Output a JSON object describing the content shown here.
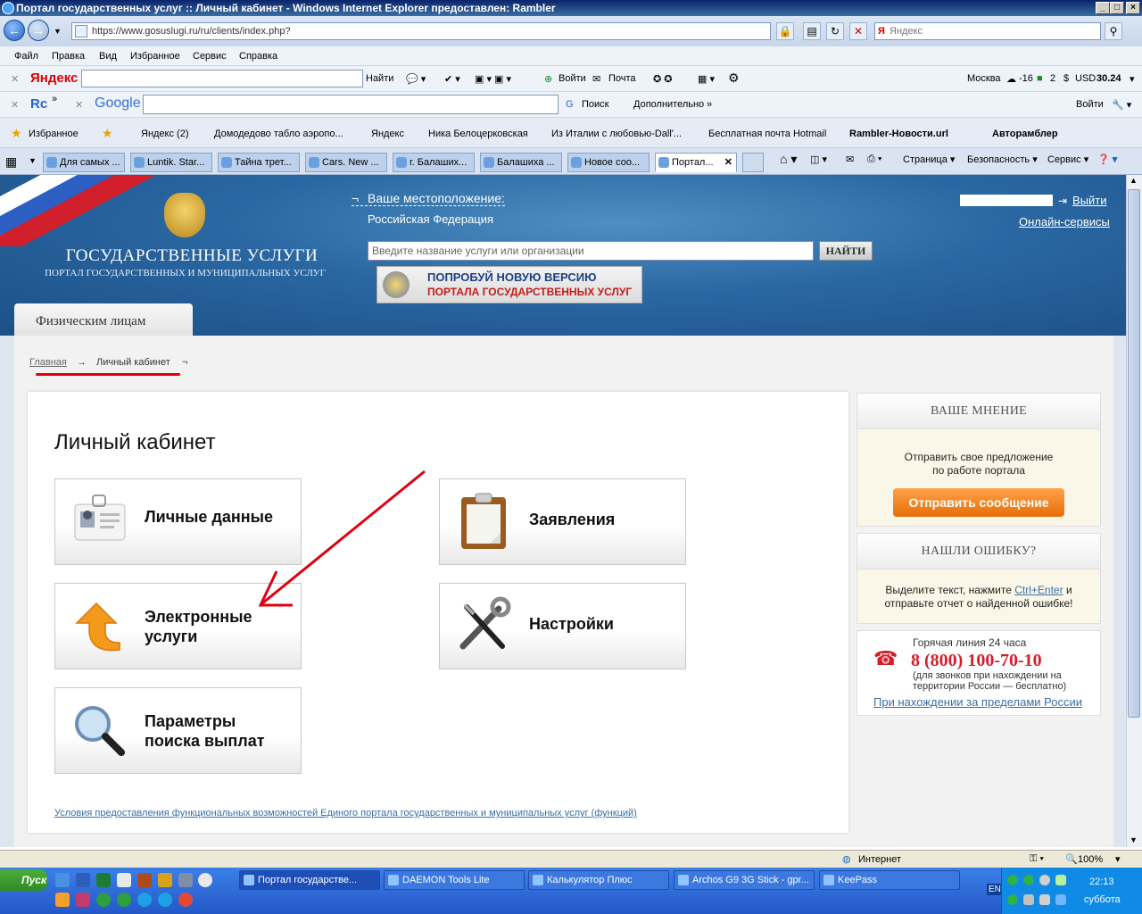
{
  "window": {
    "title": "Портал государственных услуг :: Личный кабинет - Windows Internet Explorer предоставлен: Rambler"
  },
  "browser": {
    "url": "https://www.gosuslugi.ru/ru/clients/index.php?",
    "search_placeholder": "Яндекс",
    "menu": [
      "Файл",
      "Правка",
      "Вид",
      "Избранное",
      "Сервис",
      "Справка"
    ],
    "yandex_bar": {
      "logo": "Яндекс",
      "find": "Найти",
      "login": "Войти",
      "mail": "Почта",
      "city": "Москва",
      "temp": "-16",
      "count": "2",
      "usd_label": "USD",
      "usd_value": "30.24"
    },
    "google_bar": {
      "logo": "Google",
      "search": "Поиск",
      "more": "Дополнительно",
      "login": "Войти"
    },
    "favorites": {
      "label": "Избранное",
      "items": [
        "Яндекс (2)",
        "Домодедово табло аэропо...",
        "Яндекс",
        "Ника Белоцерковская",
        "Из Италии с любовью-Dall'...",
        "Бесплатная почта Hotmail",
        "Rambler-Новости.url",
        "Авторамблер"
      ]
    },
    "tabs": [
      "Для самых ...",
      "Luntik. Star...",
      "Тайна трет...",
      "Cars. New ...",
      "г. Балаших...",
      "Балашиха ...",
      "Новое соо...",
      "Портал..."
    ],
    "commands": [
      "Страница",
      "Безопасность",
      "Сервис"
    ],
    "status": {
      "zone": "Интернет",
      "zoom": "100%"
    }
  },
  "site": {
    "logo_title": "ГОСУДАРСТВЕННЫЕ УСЛУГИ",
    "logo_subtitle": "ПОРТАЛ ГОСУДАРСТВЕННЫХ И МУНИЦИПАЛЬНЫХ УСЛУГ",
    "location_label": "Ваше местоположение:",
    "location_value": "Российская Федерация",
    "search_placeholder": "Введите название услуги или организации",
    "search_button": "НАЙТИ",
    "promo_line1": "ПОПРОБУЙ НОВУЮ ВЕРСИЮ",
    "promo_line2": "ПОРТАЛА ГОСУДАРСТВЕННЫХ УСЛУГ",
    "logout": "Выйти",
    "online_services": "Онлайн-сервисы",
    "audience_tab": "Физическим лицам",
    "breadcrumb": {
      "home": "Главная",
      "current": "Личный кабинет"
    },
    "page_title": "Личный кабинет",
    "cards": {
      "personal_data": "Личные данные",
      "applications": "Заявления",
      "e_services_l1": "Электронные",
      "e_services_l2": "услуги",
      "settings": "Настройки",
      "payments_l1": "Параметры",
      "payments_l2": "поиска выплат"
    },
    "terms_link": "Условия предоставления функциональных возможностей Единого портала государственных и муниципальных услуг (функций)",
    "opinion": {
      "title": "ВАШЕ МНЕНИЕ",
      "text_l1": "Отправить свое предложение",
      "text_l2": "по работе портала",
      "button": "Отправить сообщение"
    },
    "error": {
      "title": "НАШЛИ ОШИБКУ?",
      "text_a": "Выделите текст, нажмите",
      "shortcut": "Ctrl+Enter",
      "text_b": "и",
      "text_l2": "отправьте отчет о найденной ошибке!"
    },
    "hotline": {
      "label": "Горячая линия 24 часа",
      "phone": "8 (800) 100-70-10",
      "note_l1": "(для звонков при нахождении на",
      "note_l2": "территории России — бесплатно)",
      "abroad_link": "При нахождении за пределами России"
    }
  },
  "taskbar": {
    "start": "Пуск",
    "tasks": [
      "Портал государстве...",
      "DAEMON Tools Lite",
      "Калькулятор Плюс",
      "Archos G9 3G Stick - gpr...",
      "KeePass"
    ],
    "lang": "EN",
    "time": "22:13",
    "day": "суббота"
  },
  "colors": {
    "accent_orange": "#f28a1e",
    "annotation_red": "#e00010",
    "banner_blue": "#2a67a2"
  }
}
